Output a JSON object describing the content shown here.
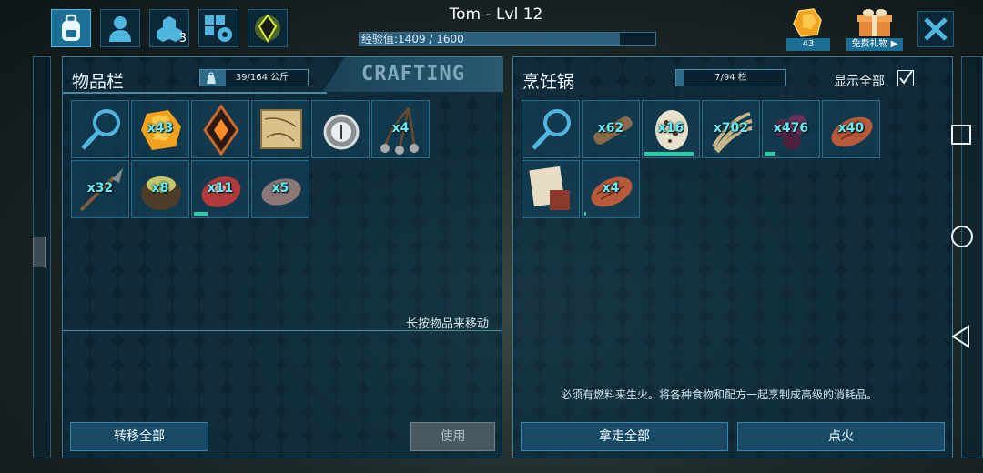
{
  "top_bar": {
    "player_name": "Tom - Lvl 12",
    "xp_text": "经验值:1409 / 1600",
    "xp_progress": 0.88,
    "engrams_count": "3",
    "tabs": [
      {
        "icon": "backpack-icon"
      },
      {
        "icon": "character-icon"
      },
      {
        "icon": "engrams-icon"
      },
      {
        "icon": "settings-icon"
      },
      {
        "icon": "tribute-crystal-icon"
      }
    ],
    "amber_count": "43",
    "free_gift_label": "免费礼物 ▶",
    "close_icon": "close-icon"
  },
  "inventory": {
    "title": "物品栏",
    "weight_text": "39/164 公斤",
    "weight_fill": 0.24,
    "crafting_tab": "CRAFTING",
    "hint": "长按物品来移动",
    "transfer_all": "转移全部",
    "use": "使用",
    "items": [
      {
        "icon": "search-icon",
        "qty": ""
      },
      {
        "icon": "amber-icon",
        "qty": "x43"
      },
      {
        "icon": "implant-icon",
        "qty": ""
      },
      {
        "icon": "map-icon",
        "qty": ""
      },
      {
        "icon": "compass-icon",
        "qty": ""
      },
      {
        "icon": "bola-icon",
        "qty": "x4"
      },
      {
        "icon": "spear-icon",
        "qty": "x32"
      },
      {
        "icon": "narcoberry-bowl-icon",
        "qty": "x8"
      },
      {
        "icon": "raw-meat-icon",
        "qty": "x11",
        "durability": 0.25
      },
      {
        "icon": "stone-icon",
        "qty": "x5"
      }
    ]
  },
  "cooking_pot": {
    "title": "烹饪锅",
    "slots_text": "7/94 栏",
    "slots_fill": 0.075,
    "show_all_label": "显示全部",
    "show_all_checked": true,
    "message": "必须有燃料来生火。将各种食物和配方一起烹制成高级的消耗品。",
    "take_all": "拿走全部",
    "ignite": "点火",
    "items": [
      {
        "icon": "search-icon",
        "qty": ""
      },
      {
        "icon": "wood-icon",
        "qty": "x62"
      },
      {
        "icon": "dodo-egg-icon",
        "qty": "x16",
        "durability": 0.9
      },
      {
        "icon": "fiber-icon",
        "qty": "x702"
      },
      {
        "icon": "berries-icon",
        "qty": "x476",
        "durability": 0.2
      },
      {
        "icon": "cooked-meat-icon",
        "qty": "x40"
      },
      {
        "icon": "note-icon",
        "qty": ""
      },
      {
        "icon": "cooked-meat-icon",
        "qty": "x4",
        "durability": 0.03
      }
    ]
  },
  "side_nav": {
    "recents_icon": "square-icon",
    "home_icon": "circle-icon",
    "back_icon": "triangle-back-icon"
  },
  "colors": {
    "accent": "#3e7d98",
    "qty": "#5ff0ff",
    "durability": "#1fd1a5"
  }
}
